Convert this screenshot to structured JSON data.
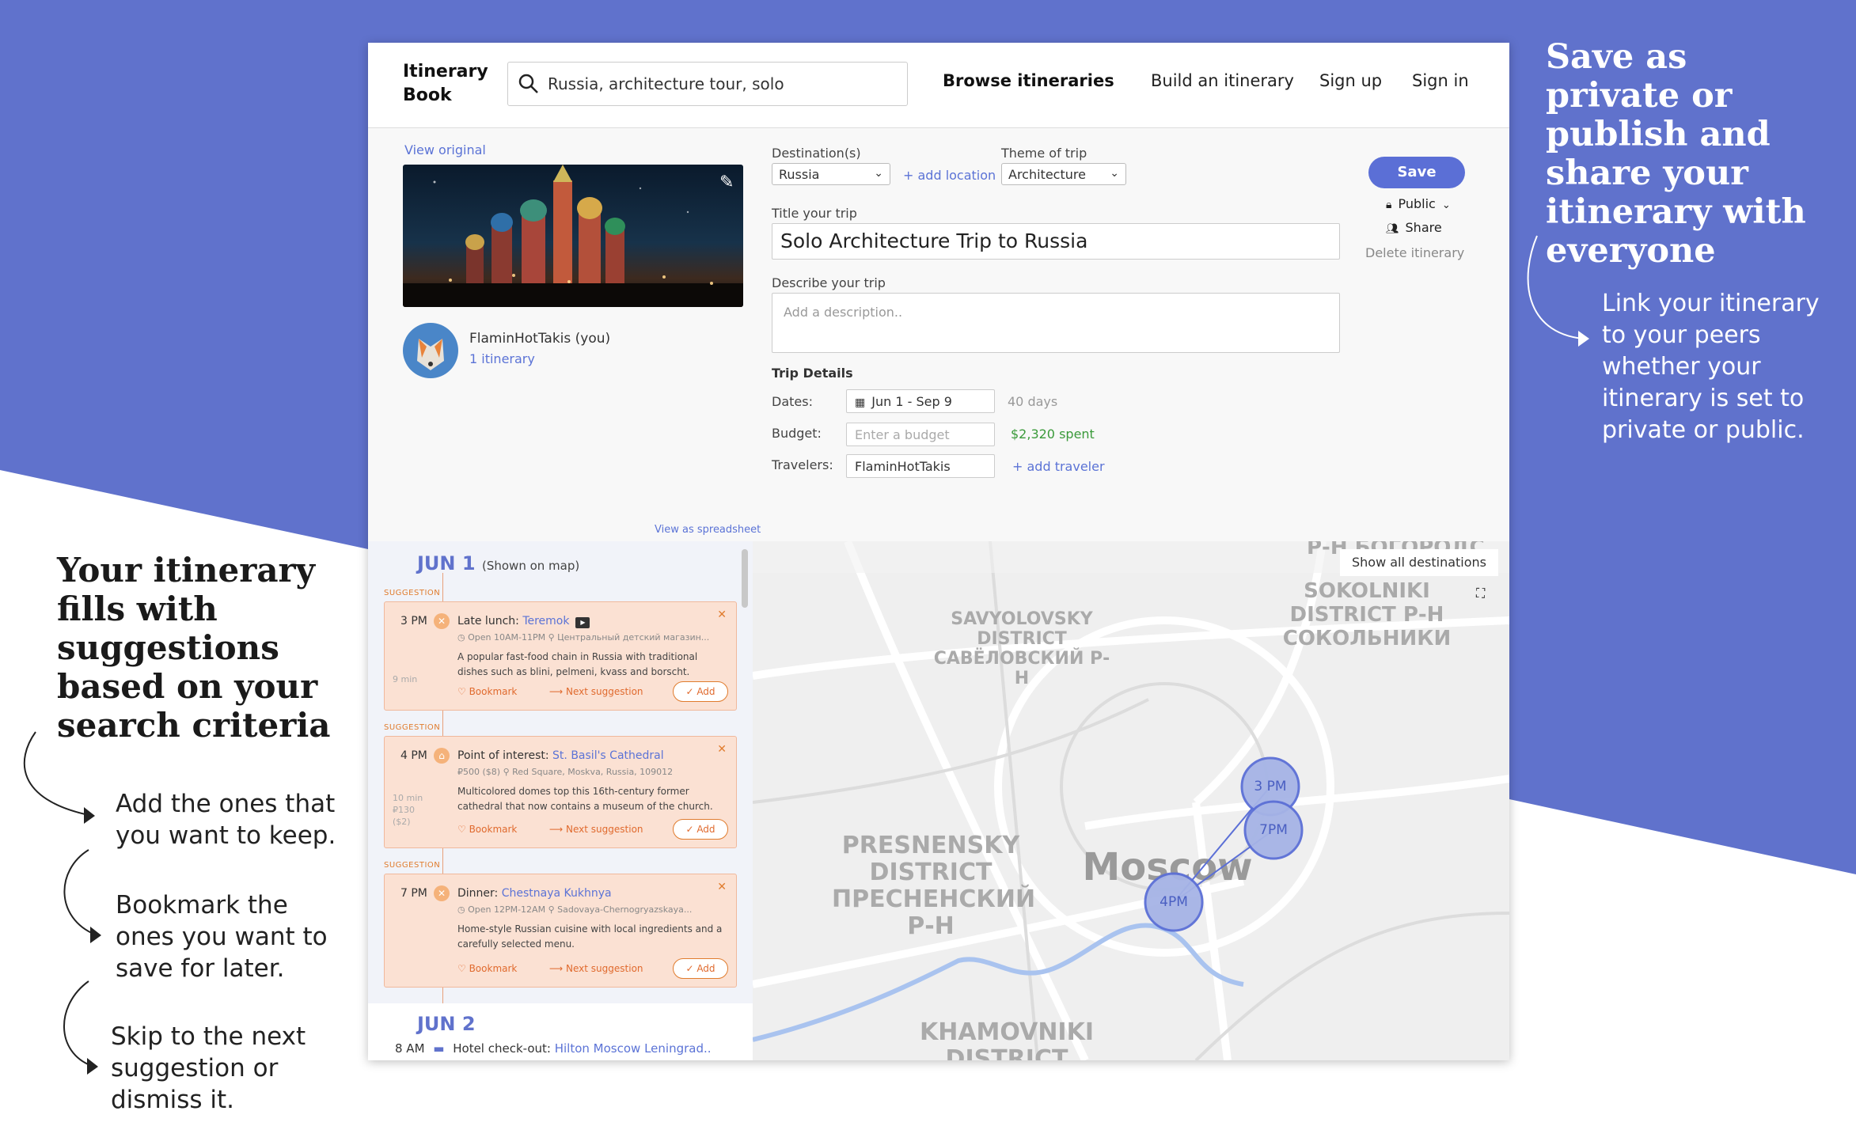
{
  "annotations": {
    "left_title": "Your itinerary fills with suggestions based on your search criteria",
    "left_steps": [
      "Add the ones that you want to keep.",
      "Bookmark the ones you want to save for later.",
      "Skip to the next suggestion or dismiss it."
    ],
    "right_title": "Save as private or publish and share your itinerary with everyone",
    "right_text": "Link your itinerary to your peers whether your itinerary is set to private or public."
  },
  "header": {
    "logo": "Itinerary Book",
    "search_value": "Russia, architecture tour, solo",
    "nav": [
      "Browse itineraries",
      "Build an itinerary",
      "Sign up",
      "Sign in"
    ]
  },
  "trip": {
    "view_original": "View original",
    "user_name": "FlaminHotTakis (you)",
    "user_itineraries": "1 itinerary",
    "destination_label": "Destination(s)",
    "destination_value": "Russia",
    "add_location": "+ add location",
    "theme_label": "Theme of trip",
    "theme_value": "Architecture",
    "title_label": "Title your trip",
    "title_value": "Solo Architecture Trip to Russia",
    "describe_label": "Describe your trip",
    "describe_placeholder": "Add a description..",
    "details_heading": "Trip Details",
    "dates_label": "Dates:",
    "dates_value": "Jun 1 - Sep 9",
    "days": "40 days",
    "budget_label": "Budget:",
    "budget_placeholder": "Enter a budget",
    "spent": "$2,320 spent",
    "travelers_label": "Travelers:",
    "traveler_value": "FlaminHotTakis",
    "add_traveler": "+ add traveler"
  },
  "actions": {
    "save": "Save",
    "visibility": "Public",
    "share": "Share",
    "delete": "Delete itinerary"
  },
  "itinerary": {
    "view_spreadsheet": "View as spreadsheet",
    "day1": "JUN 1",
    "day1_note": "(Shown on map)",
    "suggestion_tag": "SUGGESTION",
    "cards": [
      {
        "time": "3 PM",
        "type": "Late lunch: ",
        "name": "Teremok",
        "meta": "◷ Open 10AM-11PM   ⚲ Центральный детский магазин...",
        "desc": "A popular fast-food chain in Russia with traditional dishes such as blini, pelmeni, kvass and borscht.",
        "travel": "9 min"
      },
      {
        "time": "4 PM",
        "type": "Point of interest: ",
        "name": "St. Basil's Cathedral",
        "meta": "₽500 ($8)   ⚲ Red Square, Moskva, Russia, 109012",
        "desc": "Multicolored domes top this 16th-century former cathedral that now contains a museum of the church.",
        "travel": "10 min ₽130 ($2)"
      },
      {
        "time": "7 PM",
        "type": "Dinner: ",
        "name": "Chestnaya Kukhnya",
        "meta": "◷ Open 12PM-12AM   ⚲ Sadovaya-Chernogryazskaya...",
        "desc": "Home-style Russian cuisine with local ingredients and a carefully selected menu.",
        "travel": ""
      }
    ],
    "bookmark": "Bookmark",
    "next": "Next suggestion",
    "add": "Add",
    "day2": "JUN 2",
    "checkout_time": "8 AM",
    "checkout_type": "Hotel check-out: ",
    "checkout_name": "Hilton Moscow Leningrad.."
  },
  "map": {
    "show_all": "Show all destinations",
    "districts": [
      "Р-Н БОГОРОДС",
      "SOKOLNIKI DISTRICT Р-Н СОКОЛЬНИКИ",
      "SAVYOLOVSKY DISTRICT САВЁЛОВСКИЙ Р-Н",
      "PRESNENSKY DISTRICT ПРЕСНЕНСКИЙ Р-Н",
      "KHAMOVNIKI DISTRICT",
      "Moscow"
    ],
    "markers": [
      "3 PM",
      "7PM",
      "4PM"
    ],
    "colors": {
      "accent": "#6072cc",
      "marker_fill": "#a6b4e6",
      "marker_stroke": "#5b6fd6"
    }
  }
}
